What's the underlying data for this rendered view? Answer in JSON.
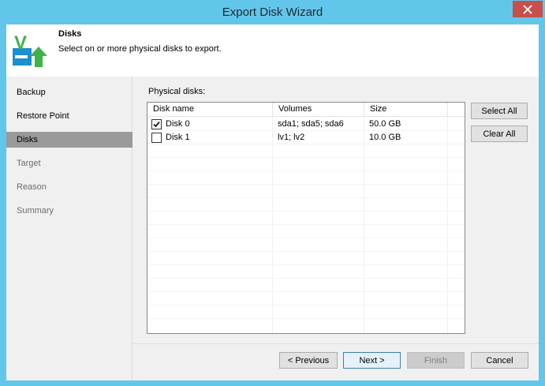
{
  "window": {
    "title": "Export Disk Wizard"
  },
  "header": {
    "title": "Disks",
    "subtitle": "Select on or more physical disks to export.",
    "logo_letter": "V"
  },
  "steps": [
    {
      "label": "Backup",
      "state": "done"
    },
    {
      "label": "Restore Point",
      "state": "done"
    },
    {
      "label": "Disks",
      "state": "active"
    },
    {
      "label": "Target",
      "state": "pending"
    },
    {
      "label": "Reason",
      "state": "pending"
    },
    {
      "label": "Summary",
      "state": "pending"
    }
  ],
  "disks": {
    "label": "Physical disks:",
    "columns": [
      "Disk name",
      "Volumes",
      "Size"
    ],
    "rows": [
      {
        "checked": true,
        "name": "Disk 0",
        "volumes": "sda1; sda5; sda6",
        "size": "50.0 GB"
      },
      {
        "checked": false,
        "name": "Disk 1",
        "volumes": "lv1; lv2",
        "size": "10.0 GB"
      }
    ]
  },
  "side_buttons": {
    "select_all": "Select All",
    "clear_all": "Clear All"
  },
  "footer": {
    "previous": "< Previous",
    "next": "Next >",
    "finish": "Finish",
    "cancel": "Cancel"
  },
  "colors": {
    "title_bar": "#62c6ea",
    "close_button": "#c7504c",
    "logo_green": "#3db34a",
    "logo_blue": "#1b8fcf"
  },
  "icons": {
    "close": "close-icon",
    "logo": "veeam-export-logo-icon",
    "check": "checkmark-icon"
  }
}
